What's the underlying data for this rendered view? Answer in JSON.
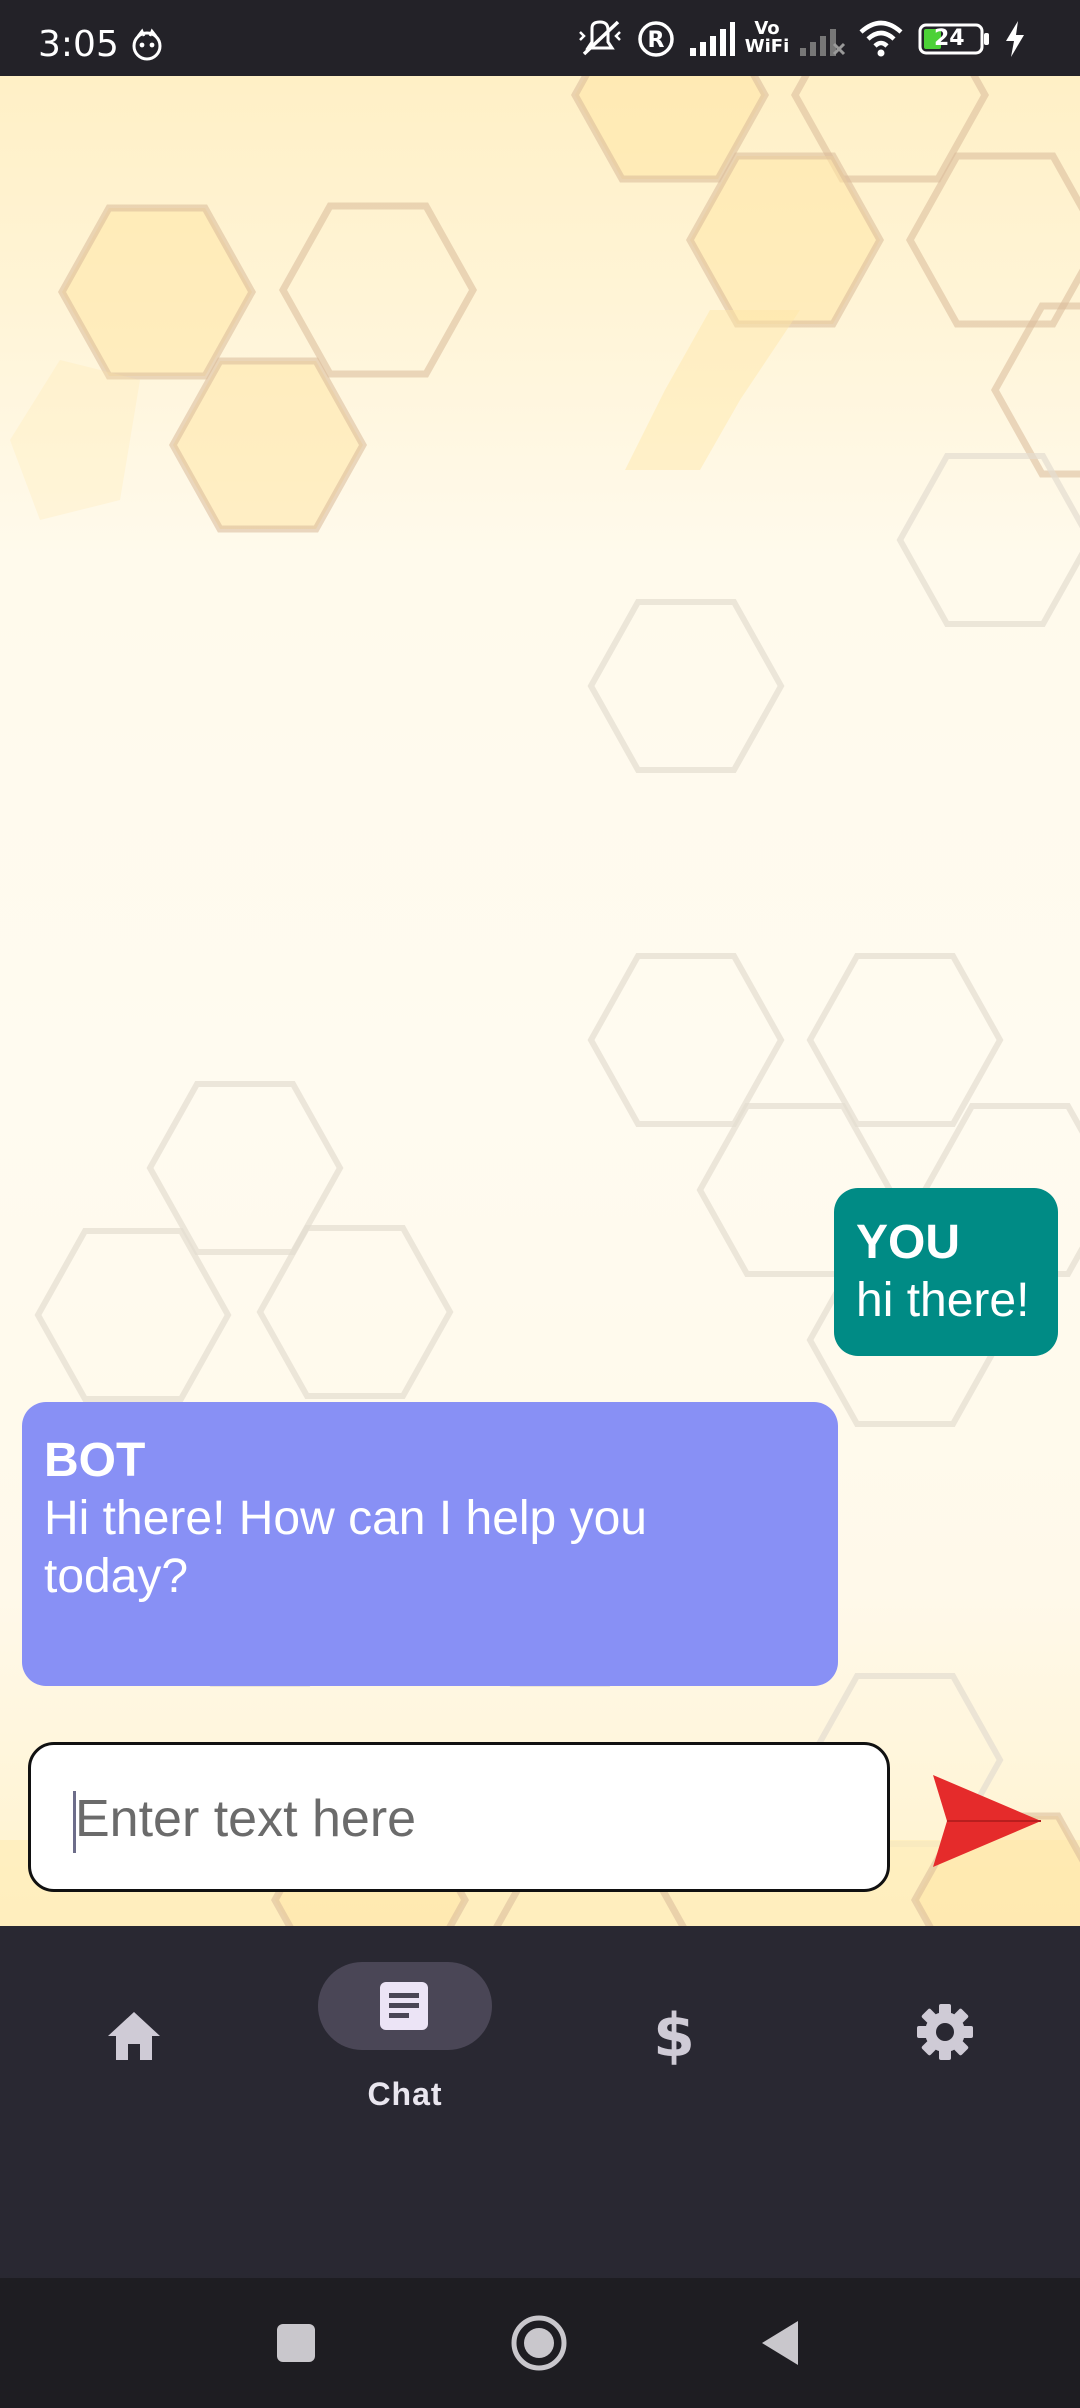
{
  "status_bar": {
    "time": "3:05",
    "battery_level": "24",
    "vowifi_top": "Vo",
    "vowifi_bottom": "WiFi",
    "icons": [
      "face-notification-icon",
      "mute-vibrate-icon",
      "roaming-r-icon",
      "signal-icon",
      "vowifi-icon",
      "signal-no-service-icon",
      "wifi-icon",
      "battery-icon",
      "charging-bolt-icon"
    ]
  },
  "chat": {
    "messages": [
      {
        "sender": "YOU",
        "text": "hi there!",
        "color": "#008b85"
      },
      {
        "sender": "BOT",
        "text_line1": "Hi there! How can I help you",
        "text_line2": "today?",
        "color": "#8890f5"
      }
    ],
    "input": {
      "placeholder": "Enter text here",
      "value": ""
    },
    "send_icon": "send-arrow-icon",
    "send_color": "#e52b2b"
  },
  "bottom_nav": {
    "items": [
      {
        "icon": "home-icon",
        "label": "",
        "active": false
      },
      {
        "icon": "chat-document-icon",
        "label": "Chat",
        "active": true
      },
      {
        "icon": "dollar-icon",
        "label": "",
        "active": false
      },
      {
        "icon": "gear-icon",
        "label": "",
        "active": false
      }
    ]
  },
  "system_nav": {
    "icons": [
      "recents-square-icon",
      "home-circle-icon",
      "back-triangle-icon"
    ]
  }
}
